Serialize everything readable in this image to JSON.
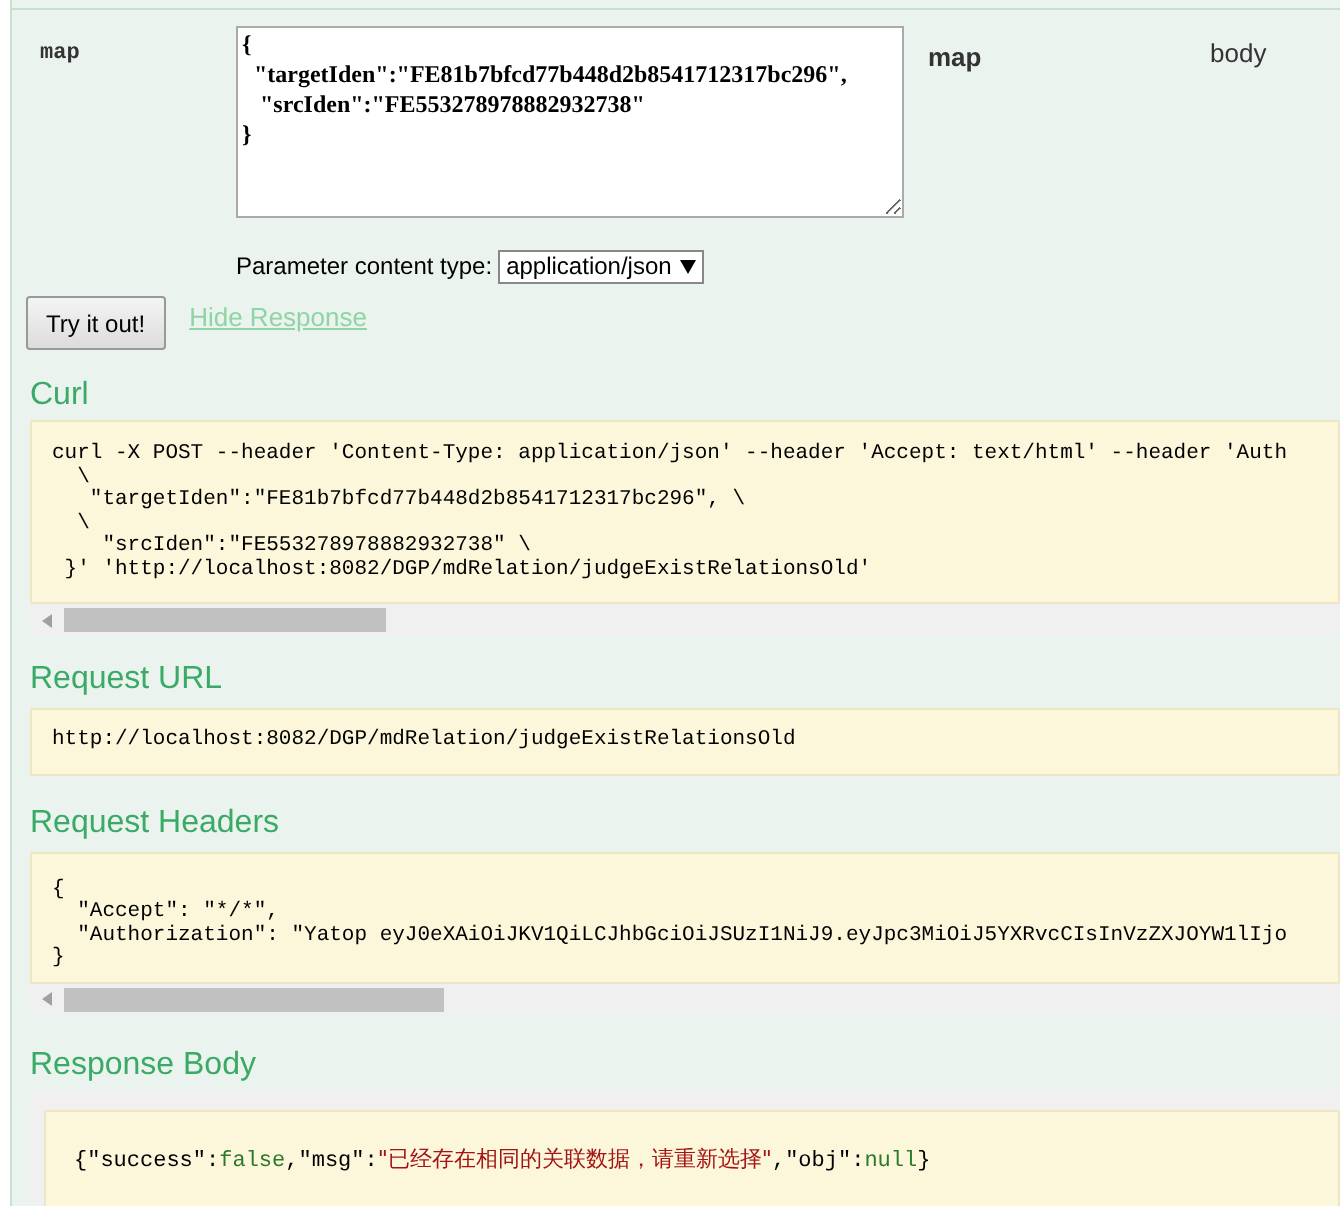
{
  "parameter": {
    "name": "map",
    "value_lines": [
      "{",
      "  \"targetIden\":\"FE81b7bfcd77b448d2b8541712317bc296\",",
      "   \"srcIden\":\"FE553278978882932738\"",
      "}"
    ],
    "data_type": "map",
    "param_type": "body",
    "content_type_label": "Parameter content type:",
    "content_type": "application/json"
  },
  "try_button": "Try it out!",
  "hide_response_link": "Hide Response",
  "sections": [
    {
      "title": "Curl",
      "lines": [
        "curl -X POST --header 'Content-Type: application/json' --header 'Accept: text/html' --header 'Auth",
        "  \\",
        "   \"targetIden\":\"FE81b7bfcd77b448d2b8541712317bc296\", \\",
        "  \\",
        "    \"srcIden\":\"FE553278978882932738\" \\",
        " }' 'http://localhost:8082/DGP/mdRelation/judgeExistRelationsOld'"
      ],
      "scrollbar": true
    },
    {
      "title": "Request URL",
      "lines": [
        "http://localhost:8082/DGP/mdRelation/judgeExistRelationsOld"
      ],
      "scrollbar": false
    },
    {
      "title": "Request Headers",
      "lines": [
        "{",
        "  \"Accept\": \"*/*\",",
        "  \"Authorization\": \"Yatop eyJ0eXAiOiJKV1QiLCJhbGciOiJSUzI1NiJ9.eyJpc3MiOiJ5YXRvcCIsInVzZXJOYW1lIjo",
        "}"
      ],
      "scrollbar": true
    }
  ],
  "response_body": {
    "title": "Response Body",
    "tokens": [
      {
        "text": "{\"success\":",
        "kind": "plain"
      },
      {
        "text": "false",
        "kind": "literal"
      },
      {
        "text": ",\"msg\":",
        "kind": "plain"
      },
      {
        "text": "\"已经存在相同的关联数据，请重新选择\"",
        "kind": "string"
      },
      {
        "text": ",\"obj\":",
        "kind": "plain"
      },
      {
        "text": "null",
        "kind": "literal"
      },
      {
        "text": "}",
        "kind": "plain"
      }
    ]
  }
}
